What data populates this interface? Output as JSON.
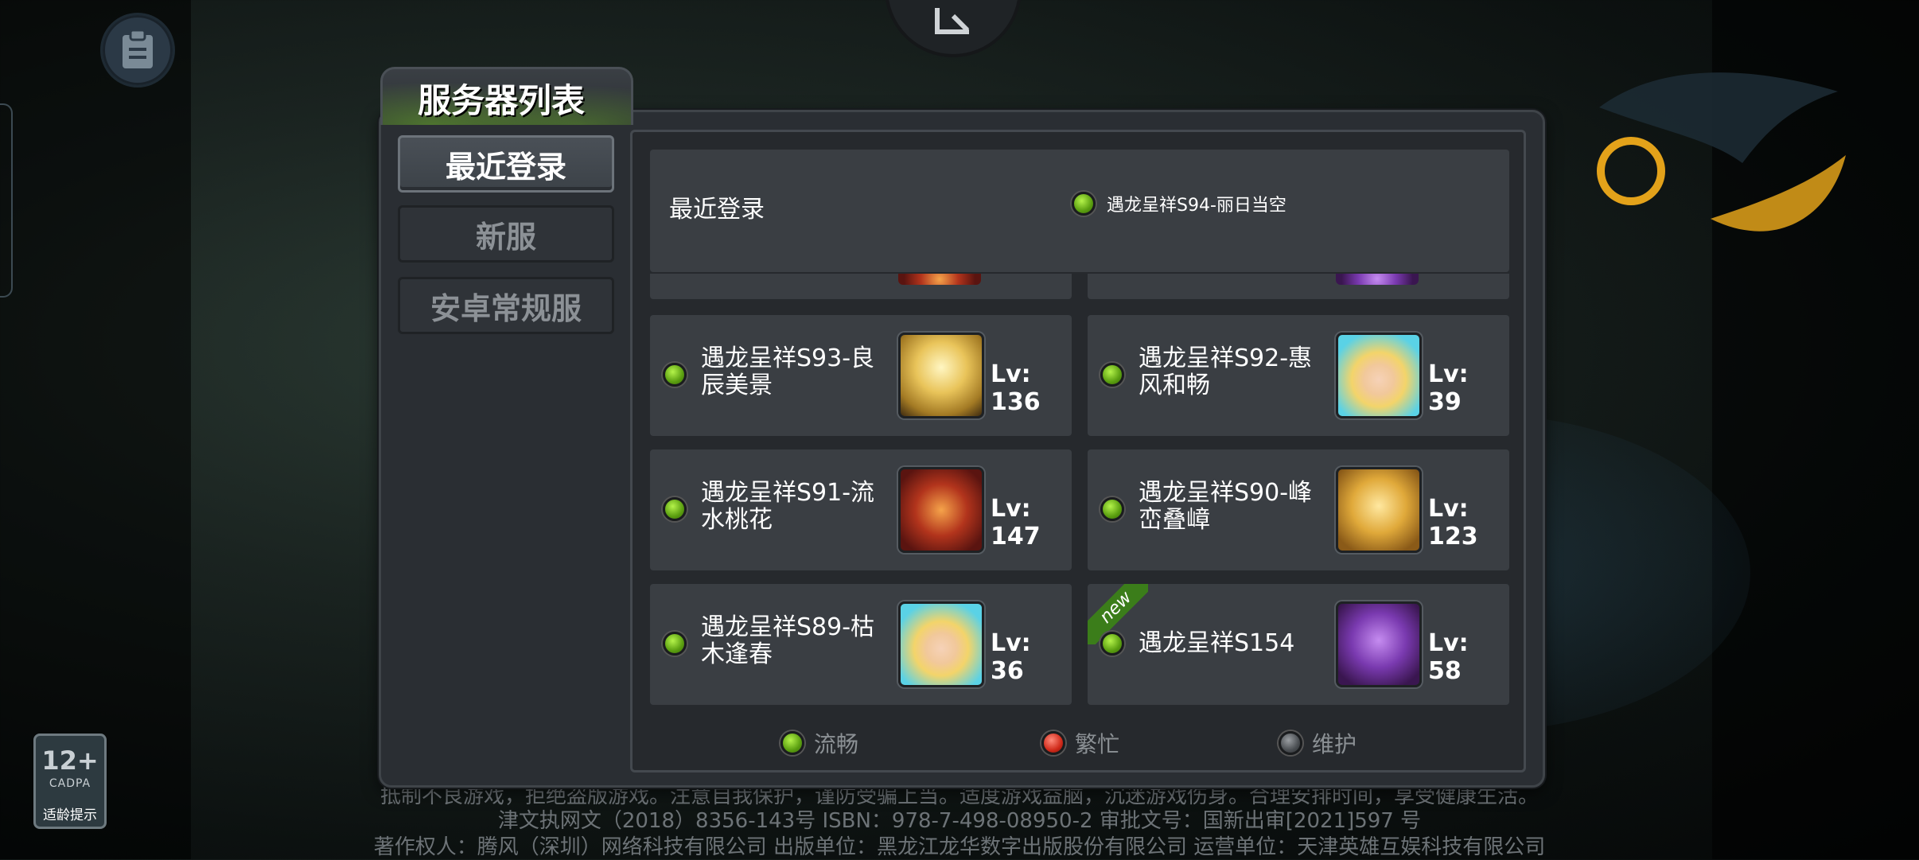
{
  "panel": {
    "title": "服务器列表"
  },
  "sidebar": {
    "items": [
      {
        "label": "最近登录",
        "active": true
      },
      {
        "label": "新服",
        "active": false
      },
      {
        "label": "安卓常规服",
        "active": false
      }
    ]
  },
  "recent": {
    "label": "最近登录",
    "server": {
      "name": "遇龙呈祥S94-丽日当空",
      "status": "green"
    }
  },
  "servers": [
    {
      "name": "遇龙呈祥S93-良辰美景",
      "level": "Lv: 136",
      "status": "green",
      "avatar": "gold-dragon-avatar",
      "new": false
    },
    {
      "name": "遇龙呈祥S92-惠风和畅",
      "level": "Lv: 39",
      "status": "green",
      "avatar": "blonde-elf-avatar",
      "new": false
    },
    {
      "name": "遇龙呈祥S91-流水桃花",
      "level": "Lv: 147",
      "status": "green",
      "avatar": "red-dragon-avatar",
      "new": false
    },
    {
      "name": "遇龙呈祥S90-峰峦叠嶂",
      "level": "Lv: 123",
      "status": "green",
      "avatar": "gold-wing-dragon-avatar",
      "new": false
    },
    {
      "name": "遇龙呈祥S89-枯木逢春",
      "level": "Lv: 36",
      "status": "green",
      "avatar": "blonde-elf-avatar",
      "new": false
    },
    {
      "name": "遇龙呈祥S154",
      "level": "Lv: 58",
      "status": "green",
      "avatar": "purple-dragon-avatar",
      "new": true,
      "badge": "new"
    }
  ],
  "legend": [
    {
      "label": "流畅",
      "color": "green"
    },
    {
      "label": "繁忙",
      "color": "red"
    },
    {
      "label": "维护",
      "color": "gray"
    }
  ],
  "rating": {
    "age": "12+",
    "org": "CADPA",
    "tip": "适龄提示"
  },
  "footer": {
    "line1": "抵制不良游戏，拒绝盗版游戏。注意自我保护，谨防受骗上当。适度游戏益脑，沉迷游戏伤身。合理安排时间，享受健康生活。",
    "line2": "津文执网文（2018）8356-143号 ISBN：978-7-498-08950-2 审批文号：国新出审[2021]597 号",
    "line3": "著作权人：腾风（深圳）网络科技有限公司 出版单位：黑龙江龙华数字出版股份有限公司 运营单位：天津英雄互娱科技有限公司"
  },
  "colors": {
    "accent_green": "#5a9e10",
    "status_red": "#d02a1a",
    "status_gray": "#4a4e52",
    "panel_bg": "#2a2e33",
    "card_bg": "#3a3e43"
  }
}
